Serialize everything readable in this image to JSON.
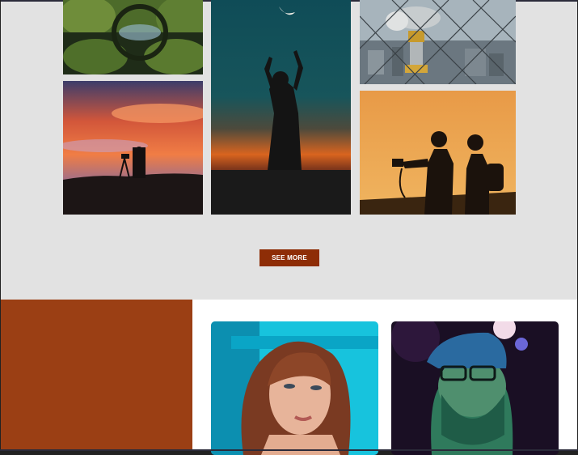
{
  "gallery": {
    "see_more_label": "SEE MORE",
    "photos": [
      {
        "subject": "reflection-lake"
      },
      {
        "subject": "sunset-photographer"
      },
      {
        "subject": "moon-silhouette"
      },
      {
        "subject": "city-telescope"
      },
      {
        "subject": "two-photographers"
      }
    ]
  },
  "team": {
    "accent_color": "#9b3f14",
    "cards": [
      {
        "subject": "portrait-woman"
      },
      {
        "subject": "portrait-bearded-man"
      }
    ]
  },
  "colors": {
    "gallery_bg": "#e2e2e2",
    "button_bg": "#8e2d06",
    "button_text": "#ffffff"
  }
}
